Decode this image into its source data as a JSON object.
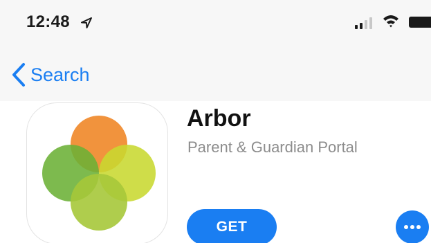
{
  "status_bar": {
    "time": "12:48",
    "icons": [
      "location-arrow-icon",
      "cellular-signal-icon",
      "wifi-icon",
      "battery-icon"
    ]
  },
  "navigation": {
    "back_label": "Search",
    "back_icon": "chevron-left-icon"
  },
  "app": {
    "name": "Arbor",
    "subtitle": "Parent & Guardian Portal",
    "get_label": "GET",
    "more_icon": "ellipsis-icon",
    "icon_name": "arbor-app-icon"
  },
  "colors": {
    "accent": "#1a7ef2",
    "status_bar_background": "#f7f7f7",
    "subtitle_text": "#8c8c8c",
    "logo_orange": "#f08a2c",
    "logo_dark_green": "#6bb035",
    "logo_light_green": "#c8d830",
    "logo_lime": "#a6c83a"
  }
}
